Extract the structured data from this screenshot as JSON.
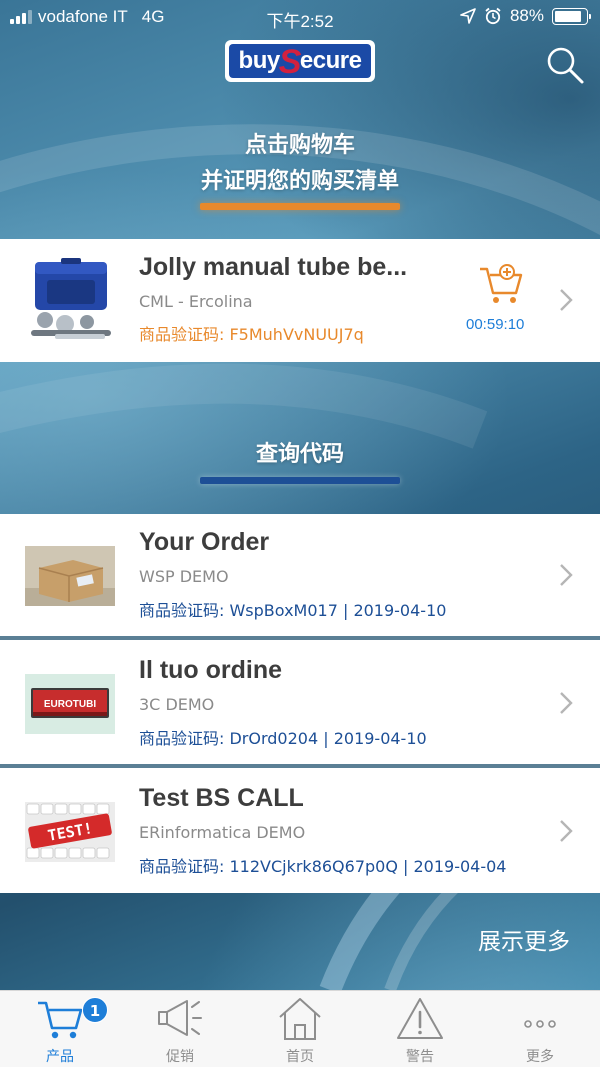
{
  "status_bar": {
    "carrier": "vodafone IT",
    "network": "4G",
    "time": "下午2:52",
    "battery": "88%",
    "battery_level": 0.88
  },
  "header": {
    "logo_left": "buy",
    "logo_s": "S",
    "logo_right": "ecure"
  },
  "cart_section": {
    "heading_line1": "点击购物车",
    "heading_line2": "并证明您的购买清单",
    "accent_color": "#e8892c",
    "item": {
      "title": "Jolly manual tube be...",
      "subtitle": "CML - Ercolina",
      "code": "商品验证码: F5MuhVvNUUJ7q",
      "timer": "00:59:10"
    }
  },
  "query_section": {
    "heading": "查询代码",
    "accent_color": "#1d4f96",
    "items": [
      {
        "title": "Your Order",
        "subtitle": "WSP DEMO",
        "code": "商品验证码: WspBoxM017 | 2019-04-10"
      },
      {
        "title": "Il tuo ordine",
        "subtitle": "3C DEMO",
        "code": "商品验证码: DrOrd0204 | 2019-04-10",
        "thumb_text": "EUROTUBI"
      },
      {
        "title": "Test BS CALL",
        "subtitle": "ERinformatica DEMO",
        "code": "商品验证码: 112VCjkrk86Q67p0Q | 2019-04-04",
        "thumb_text": "TEST!"
      }
    ]
  },
  "more_label": "展示更多",
  "tab_bar": {
    "active_color": "#1e7ed8",
    "tabs": [
      {
        "label": "产品",
        "icon": "cart-icon",
        "badge": "1"
      },
      {
        "label": "促销",
        "icon": "megaphone-icon"
      },
      {
        "label": "首页",
        "icon": "home-icon"
      },
      {
        "label": "警告",
        "icon": "warning-icon"
      },
      {
        "label": "更多",
        "icon": "more-dots-icon"
      }
    ]
  }
}
